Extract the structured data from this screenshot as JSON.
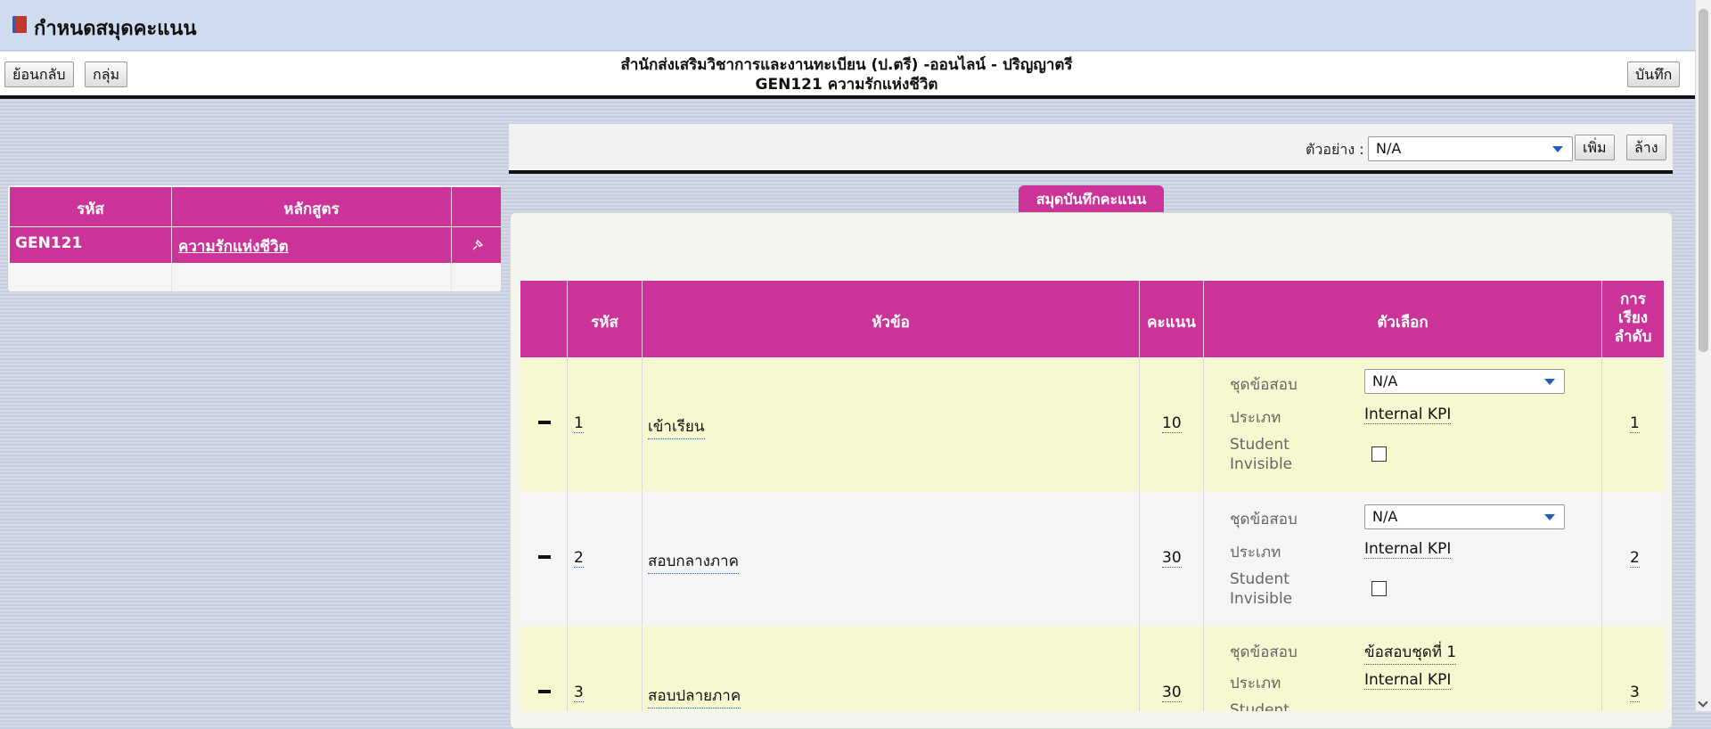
{
  "page": {
    "title": "กำหนดสมุดคะแนน",
    "header_line1": "สำนักส่งเสริมวิชาการและงานทะเบียน (ป.ตรี) -ออนไลน์ - ปริญญาตรี",
    "header_line2": "GEN121 ความรักแห่งชีวิต"
  },
  "toolbar": {
    "back_label": "ย้อนกลับ",
    "group_label": "กลุ่ม",
    "save_label": "บันทึก",
    "example_label": "ตัวอย่าง :",
    "example_value": "N/A",
    "add_label": "เพิ่ม",
    "clear_label": "ล้าง"
  },
  "course_table": {
    "headers": {
      "code": "รหัส",
      "course": "หลักสูตร"
    },
    "row": {
      "code": "GEN121",
      "name": "ความรักแห่งชีวิต"
    }
  },
  "gradebook": {
    "tab_label": "สมุดบันทึกคะแนน",
    "headers": {
      "code": "รหัส",
      "topic": "หัวข้อ",
      "score": "คะแนน",
      "options": "ตัวเลือก",
      "order_l1": "การ",
      "order_l2": "เรียง",
      "order_l3": "ลำดับ"
    },
    "option_labels": {
      "exam_set": "ชุดข้อสอบ",
      "type": "ประเภท",
      "student_l1": "Student",
      "student_l2": "Invisible"
    },
    "rows": [
      {
        "code": "1",
        "topic": "เข้าเรียน",
        "score": "10",
        "exam_set": "N/A",
        "type": "Internal KPI",
        "order": "1"
      },
      {
        "code": "2",
        "topic": "สอบกลางภาค",
        "score": "30",
        "exam_set": "N/A",
        "type": "Internal KPI",
        "order": "2"
      },
      {
        "code": "3",
        "topic": "สอบปลายภาค",
        "score": "30",
        "exam_set": "ข้อสอบชุดที่ 1",
        "type": "Internal KPI",
        "order": "3"
      }
    ]
  },
  "colors": {
    "accent": "#cc3399",
    "row_alt": "#f7f7d0",
    "link": "#1f5fbf"
  }
}
